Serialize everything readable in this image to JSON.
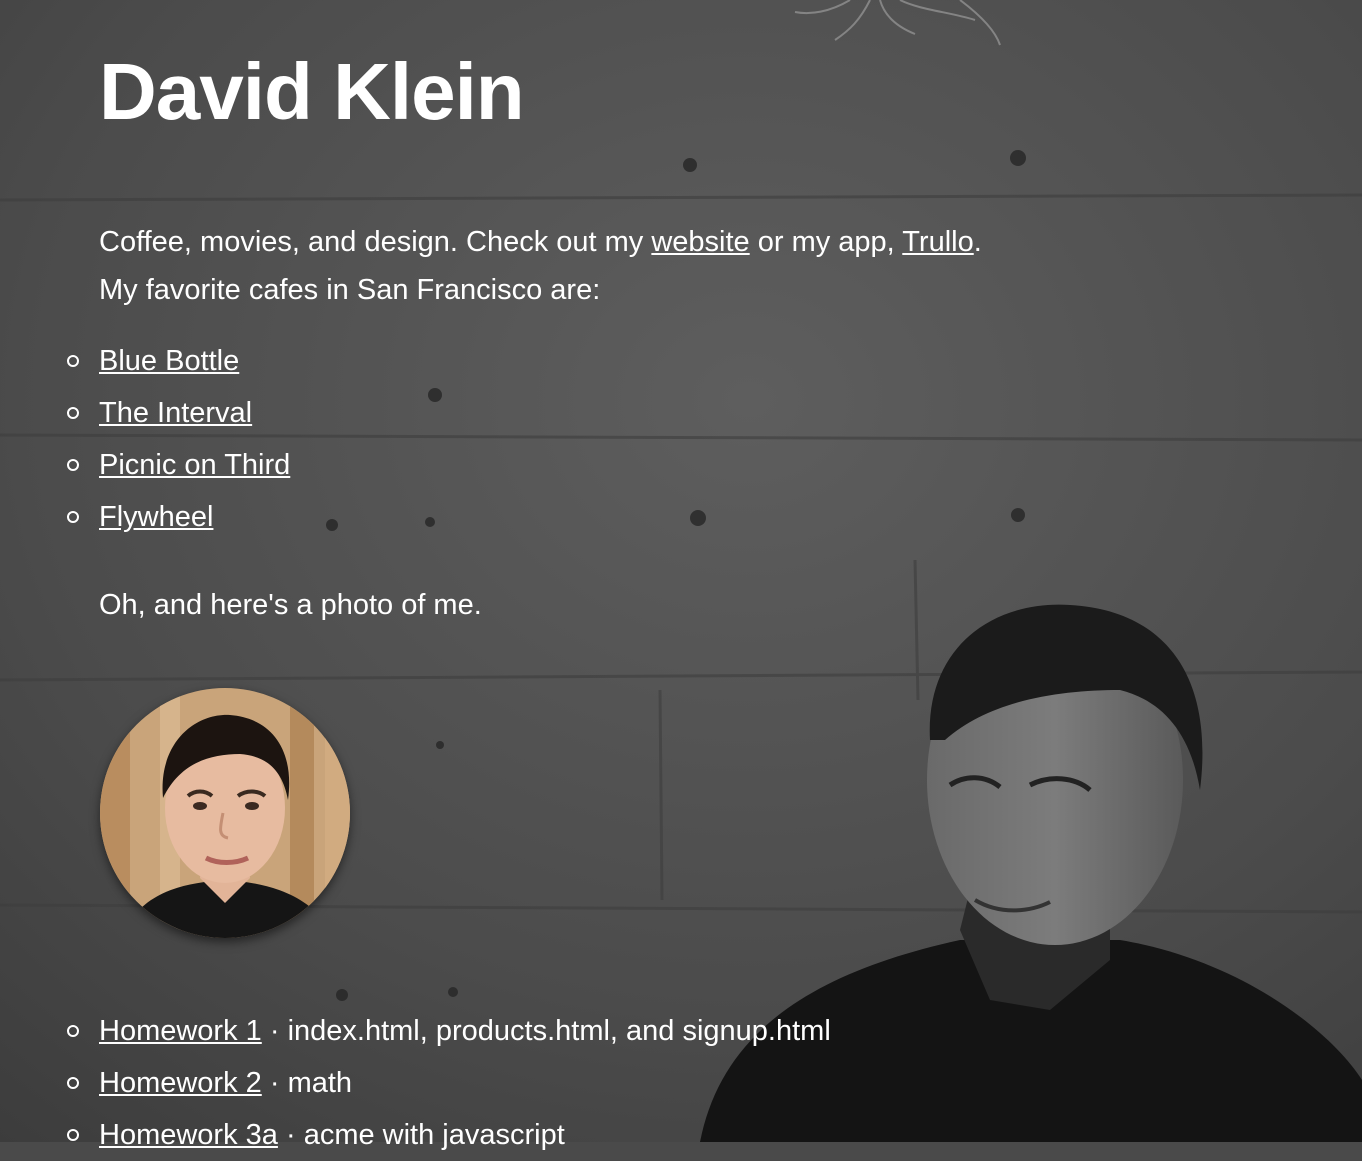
{
  "profile": {
    "name": "David Klein",
    "intro_prefix": "Coffee, movies, and design. Check out my ",
    "website_link": "website",
    "intro_middle": " or my app, ",
    "app_link": "Trullo",
    "intro_end": ".",
    "cafes_intro": "My favorite cafes in San Francisco are:"
  },
  "cafes": [
    {
      "label": "Blue Bottle"
    },
    {
      "label": "The Interval"
    },
    {
      "label": "Picnic on Third"
    },
    {
      "label": "Flywheel"
    }
  ],
  "photo_note": "Oh, and here's a photo of me.",
  "homework": [
    {
      "label": "Homework 1",
      "separator": " · ",
      "description": "index.html, products.html, and signup.html"
    },
    {
      "label": "Homework 2",
      "separator": " · ",
      "description": "math"
    },
    {
      "label": "Homework 3a",
      "separator": " · ",
      "description": "acme with javascript"
    }
  ],
  "colors": {
    "text": "#ffffff",
    "background": "#4a4a4a",
    "avatar_backdrop": "#c9a47a"
  }
}
